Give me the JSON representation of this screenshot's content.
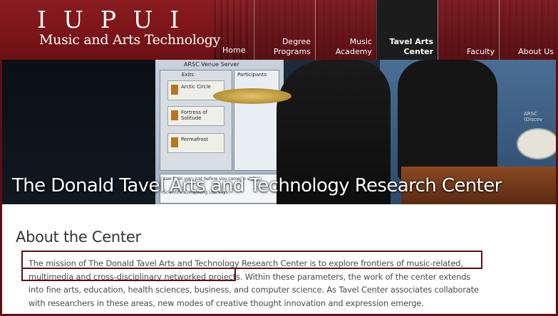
{
  "logo": {
    "title": "IUPUI",
    "subtitle": "Music and Arts Technology"
  },
  "nav": {
    "home": "Home",
    "items": [
      {
        "label": "Degree\nPrograms",
        "active": false
      },
      {
        "label": "Music\nAcademy",
        "active": false
      },
      {
        "label": "Tavel Arts\nCenter",
        "active": true
      },
      {
        "label": "Faculty",
        "active": false
      },
      {
        "label": "About Us",
        "active": false
      }
    ]
  },
  "hero": {
    "title": "The Donald Tavel Arts and Technology Research Center",
    "screen_header": "ARSC Venue Server",
    "screen_exits": "Exits",
    "screen_participants": "Participants",
    "screen_items": [
      "Arctic Circle",
      "Fortress of Solitude",
      "Permafrost"
    ],
    "screen_chat": "saw from you, just before you came to visit.",
    "screen_chat2": "Scientific Computing Ltd. says:",
    "screen_right": "ARSC (Discov"
  },
  "content": {
    "title": "About the Center",
    "body": "The mission of The Donald Tavel Arts and Technology Research Center is to explore frontiers of music-related, multimedia and cross-disciplinary networked projects. Within these parameters, the work of the center extends into fine arts, education, health sciences, business, and computer science. As Tavel Center associates collaborate with researchers in these areas, new modes of creative thought innovation and expression emerge."
  },
  "colors": {
    "header_bg": "#7a1418",
    "frame": "#5e0f12",
    "highlight": "#5a0f14",
    "active_tab": "#1c1c1c"
  }
}
